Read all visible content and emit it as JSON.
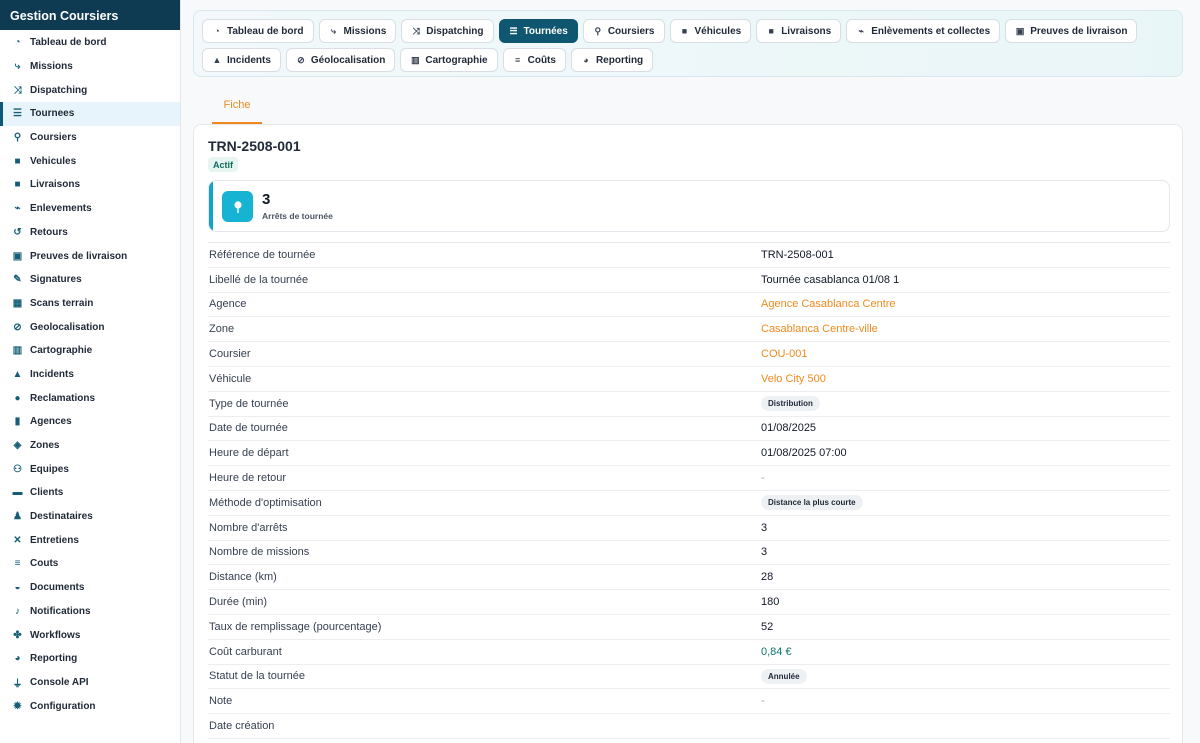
{
  "app": {
    "title": "Gestion Coursiers"
  },
  "sidebar": {
    "items": [
      {
        "label": "Tableau de bord",
        "icon": "dashboard-icon",
        "glyph": "◔"
      },
      {
        "label": "Missions",
        "icon": "route-icon",
        "glyph": "⤷"
      },
      {
        "label": "Dispatching",
        "icon": "shuffle-icon",
        "glyph": "⤨"
      },
      {
        "label": "Tournees",
        "icon": "signpost-icon",
        "glyph": "☰",
        "active": true
      },
      {
        "label": "Coursiers",
        "icon": "bicycle-icon",
        "glyph": "⚲"
      },
      {
        "label": "Vehicules",
        "icon": "truck-icon",
        "glyph": "■"
      },
      {
        "label": "Livraisons",
        "icon": "delivery-truck-icon",
        "glyph": "■"
      },
      {
        "label": "Enlevements",
        "icon": "pickup-icon",
        "glyph": "⌁"
      },
      {
        "label": "Retours",
        "icon": "undo-icon",
        "glyph": "↺"
      },
      {
        "label": "Preuves de livraison",
        "icon": "clipboard-check-icon",
        "glyph": "▣"
      },
      {
        "label": "Signatures",
        "icon": "signature-icon",
        "glyph": "✎"
      },
      {
        "label": "Scans terrain",
        "icon": "qr-code-icon",
        "glyph": "▦"
      },
      {
        "label": "Geolocalisation",
        "icon": "satellite-icon",
        "glyph": "⊘"
      },
      {
        "label": "Cartographie",
        "icon": "map-icon",
        "glyph": "▥"
      },
      {
        "label": "Incidents",
        "icon": "warning-icon",
        "glyph": "▲"
      },
      {
        "label": "Reclamations",
        "icon": "comment-icon",
        "glyph": "●"
      },
      {
        "label": "Agences",
        "icon": "building-icon",
        "glyph": "▮"
      },
      {
        "label": "Zones",
        "icon": "zones-icon",
        "glyph": "◈"
      },
      {
        "label": "Equipes",
        "icon": "users-icon",
        "glyph": "⚇"
      },
      {
        "label": "Clients",
        "icon": "briefcase-icon",
        "glyph": "▬"
      },
      {
        "label": "Destinataires",
        "icon": "user-icon",
        "glyph": "♟"
      },
      {
        "label": "Entretiens",
        "icon": "tools-icon",
        "glyph": "✕"
      },
      {
        "label": "Couts",
        "icon": "coins-icon",
        "glyph": "≡"
      },
      {
        "label": "Documents",
        "icon": "folder-icon",
        "glyph": "◒"
      },
      {
        "label": "Notifications",
        "icon": "bell-icon",
        "glyph": "♪"
      },
      {
        "label": "Workflows",
        "icon": "workflow-icon",
        "glyph": "✤"
      },
      {
        "label": "Reporting",
        "icon": "chart-pie-icon",
        "glyph": "◕"
      },
      {
        "label": "Console API",
        "icon": "plug-icon",
        "glyph": "⏚"
      },
      {
        "label": "Configuration",
        "icon": "gear-icon",
        "glyph": "✹"
      }
    ]
  },
  "topnav": {
    "items": [
      {
        "label": "Tableau de bord",
        "icon": "dashboard-icon",
        "glyph": "◔"
      },
      {
        "label": "Missions",
        "icon": "route-icon",
        "glyph": "⤷"
      },
      {
        "label": "Dispatching",
        "icon": "shuffle-icon",
        "glyph": "⤨"
      },
      {
        "label": "Tournées",
        "icon": "signpost-icon",
        "glyph": "☰",
        "active": true
      },
      {
        "label": "Coursiers",
        "icon": "bicycle-icon",
        "glyph": "⚲"
      },
      {
        "label": "Véhicules",
        "icon": "truck-icon",
        "glyph": "■"
      },
      {
        "label": "Livraisons",
        "icon": "delivery-truck-icon",
        "glyph": "■"
      },
      {
        "label": "Enlèvements et collectes",
        "icon": "pickup-icon",
        "glyph": "⌁"
      },
      {
        "label": "Preuves de livraison",
        "icon": "clipboard-check-icon",
        "glyph": "▣"
      },
      {
        "label": "Incidents",
        "icon": "warning-icon",
        "glyph": "▲"
      },
      {
        "label": "Géolocalisation",
        "icon": "satellite-icon",
        "glyph": "⊘"
      },
      {
        "label": "Cartographie",
        "icon": "map-icon",
        "glyph": "▥"
      },
      {
        "label": "Coûts",
        "icon": "coins-icon",
        "glyph": "≡"
      },
      {
        "label": "Reporting",
        "icon": "chart-pie-icon",
        "glyph": "◕"
      }
    ]
  },
  "tabs": {
    "fiche": "Fiche"
  },
  "record": {
    "title": "TRN-2508-001",
    "status": "Actif",
    "stat": {
      "value": "3",
      "label": "Arrêts de tournée",
      "icon": "map-pin-icon"
    },
    "fields": [
      {
        "label": "Référence de tournée",
        "value": "TRN-2508-001",
        "kind": "text"
      },
      {
        "label": "Libellé de la tournée",
        "value": "Tournée casablanca 01/08 1",
        "kind": "text"
      },
      {
        "label": "Agence",
        "value": "Agence Casablanca Centre",
        "kind": "link"
      },
      {
        "label": "Zone",
        "value": "Casablanca Centre-ville",
        "kind": "link"
      },
      {
        "label": "Coursier",
        "value": "COU-001",
        "kind": "link"
      },
      {
        "label": "Véhicule",
        "value": "Velo City 500",
        "kind": "link"
      },
      {
        "label": "Type de tournée",
        "value": "Distribution",
        "kind": "chip"
      },
      {
        "label": "Date de tournée",
        "value": "01/08/2025",
        "kind": "text"
      },
      {
        "label": "Heure de départ",
        "value": "01/08/2025 07:00",
        "kind": "text"
      },
      {
        "label": "Heure de retour",
        "value": "-",
        "kind": "dash"
      },
      {
        "label": "Méthode d'optimisation",
        "value": "Distance la plus courte",
        "kind": "chip"
      },
      {
        "label": "Nombre d'arrêts",
        "value": "3",
        "kind": "text"
      },
      {
        "label": "Nombre de missions",
        "value": "3",
        "kind": "text"
      },
      {
        "label": "Distance (km)",
        "value": "28",
        "kind": "text"
      },
      {
        "label": "Durée (min)",
        "value": "180",
        "kind": "text"
      },
      {
        "label": "Taux de remplissage (pourcentage)",
        "value": "52",
        "kind": "text"
      },
      {
        "label": "Coût carburant",
        "value": "0,84 €",
        "kind": "money"
      },
      {
        "label": "Statut de la tournée",
        "value": "Annulée",
        "kind": "chip"
      },
      {
        "label": "Note",
        "value": "-",
        "kind": "dash"
      },
      {
        "label": "Date création",
        "value": "",
        "kind": "text"
      }
    ]
  }
}
